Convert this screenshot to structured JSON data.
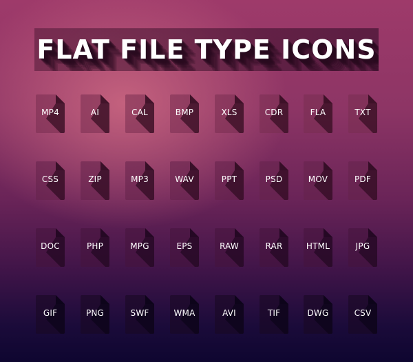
{
  "title": "FLAT FILE TYPE ICONS",
  "rows": [
    [
      "MP4",
      "AI",
      "CAL",
      "BMP",
      "XLS",
      "CDR",
      "FLA",
      "TXT"
    ],
    [
      "CSS",
      "ZIP",
      "MP3",
      "WAV",
      "PPT",
      "PSD",
      "MOV",
      "PDF"
    ],
    [
      "DOC",
      "PHP",
      "MPG",
      "EPS",
      "RAW",
      "RAR",
      "HTML",
      "JPG"
    ],
    [
      "GIF",
      "PNG",
      "SWF",
      "WMA",
      "AVI",
      "TIF",
      "DWG",
      "CSV"
    ]
  ],
  "icon": "file-document-icon",
  "colors": {
    "title_text": "#ffffff",
    "label_text": "#ffffff"
  }
}
